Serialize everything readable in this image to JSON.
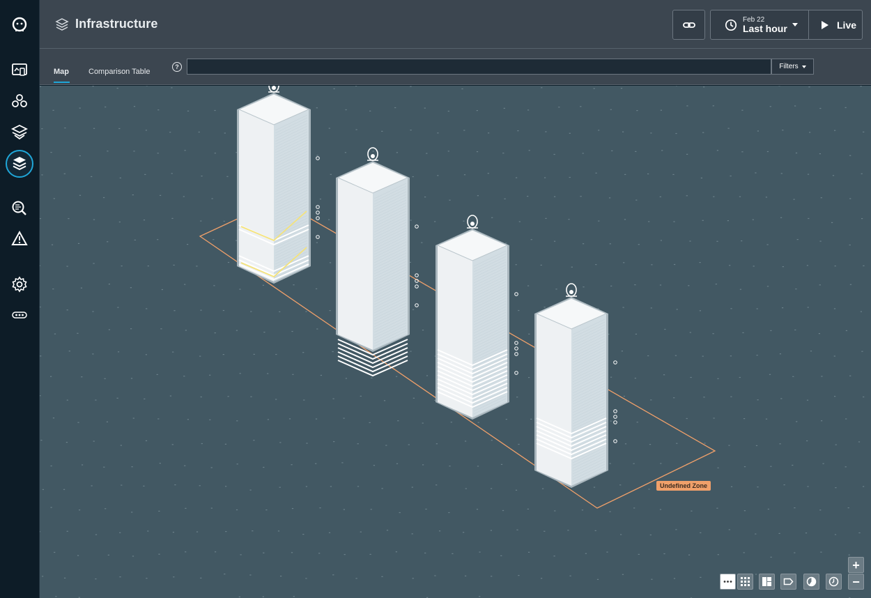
{
  "header": {
    "title": "Infrastructure",
    "date": "Feb 22",
    "time_range": "Last hour",
    "live_label": "Live"
  },
  "sidebar": {
    "items": [
      {
        "name": "logo-icon"
      },
      {
        "name": "websites-icon"
      },
      {
        "name": "applications-icon"
      },
      {
        "name": "platforms-icon"
      },
      {
        "name": "infrastructure-icon",
        "active": true
      },
      {
        "name": "analytics-icon"
      },
      {
        "name": "events-icon"
      },
      {
        "name": "settings-icon"
      },
      {
        "name": "more-icon"
      }
    ]
  },
  "tabs": {
    "map_label": "Map",
    "comparison_label": "Comparison Table"
  },
  "help_label": "?",
  "search": {
    "value": "",
    "placeholder": ""
  },
  "filters_label": "Filters",
  "zone_label": "Undefined Zone",
  "zoom": {
    "in_label": "+",
    "out_label": "−"
  },
  "colors": {
    "accent": "#1fa6d8",
    "map_background": "#425863",
    "zone_outline": "#f0a06a",
    "highlight": "#f5e37a"
  },
  "view_controls": [
    {
      "name": "list-view-icon",
      "active": true
    },
    {
      "name": "grid-view-icon",
      "active": false
    },
    {
      "name": "treemap-view-icon",
      "active": false
    },
    {
      "name": "tag-icon",
      "active": false
    },
    {
      "name": "pie-icon",
      "active": false
    },
    {
      "name": "clock-icon",
      "active": false
    }
  ]
}
